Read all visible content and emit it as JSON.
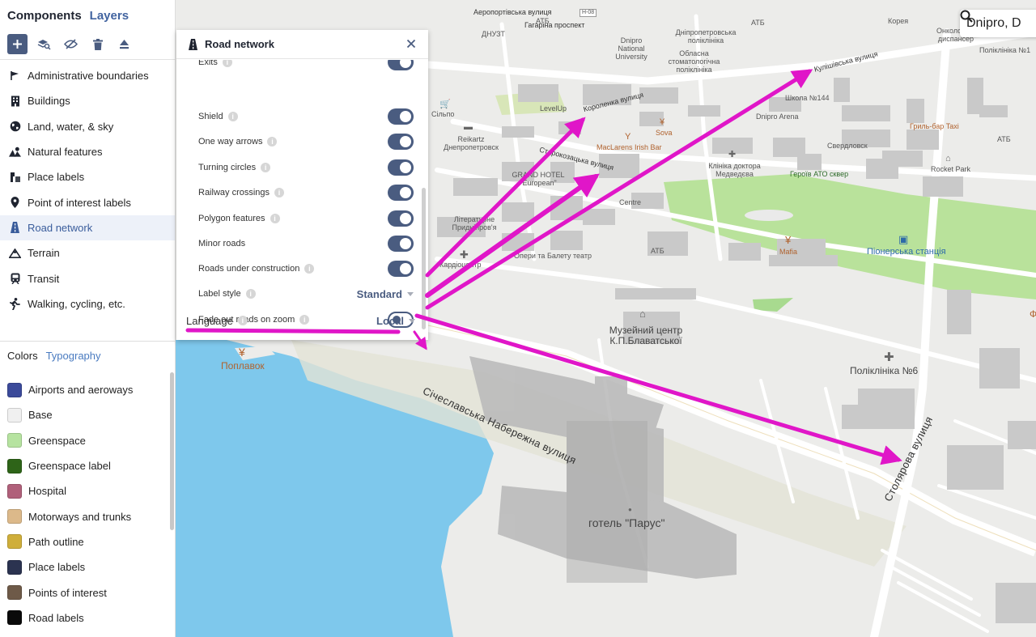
{
  "sidebar": {
    "tabs": {
      "components": "Components",
      "layers": "Layers"
    },
    "components": [
      {
        "label": "Administrative boundaries",
        "icon": "flag-icon"
      },
      {
        "label": "Buildings",
        "icon": "building-icon"
      },
      {
        "label": "Land, water, & sky",
        "icon": "globe-icon"
      },
      {
        "label": "Natural features",
        "icon": "mountain-trees-icon"
      },
      {
        "label": "Place labels",
        "icon": "place-labels-icon"
      },
      {
        "label": "Point of interest labels",
        "icon": "pin-icon"
      },
      {
        "label": "Road network",
        "icon": "road-icon",
        "active": true
      },
      {
        "label": "Terrain",
        "icon": "terrain-icon"
      },
      {
        "label": "Transit",
        "icon": "train-icon"
      },
      {
        "label": "Walking, cycling, etc.",
        "icon": "walking-icon"
      }
    ],
    "subtabs": {
      "colors": "Colors",
      "typography": "Typography"
    },
    "colors": [
      {
        "label": "Airports and aeroways",
        "color": "#3b4a9a"
      },
      {
        "label": "Base",
        "color": "#f0f0f0"
      },
      {
        "label": "Greenspace",
        "color": "#b6e3a0"
      },
      {
        "label": "Greenspace label",
        "color": "#2e6418"
      },
      {
        "label": "Hospital",
        "color": "#b0607a"
      },
      {
        "label": "Motorways and trunks",
        "color": "#dcb98a"
      },
      {
        "label": "Path outline",
        "color": "#cfae3a"
      },
      {
        "label": "Place labels",
        "color": "#2b3350"
      },
      {
        "label": "Points of interest",
        "color": "#6e5a48"
      },
      {
        "label": "Road labels",
        "color": "#0a0a0a"
      }
    ]
  },
  "panel": {
    "title": "Road network",
    "rows": [
      {
        "label": "Exits",
        "type": "toggle",
        "on": true
      },
      {
        "label": "Shield",
        "type": "toggle",
        "on": true
      },
      {
        "label": "One way arrows",
        "type": "toggle",
        "on": true
      },
      {
        "label": "Turning circles",
        "type": "toggle",
        "on": true
      },
      {
        "label": "Railway crossings",
        "type": "toggle",
        "on": true
      },
      {
        "label": "Polygon features",
        "type": "toggle",
        "on": true
      },
      {
        "label": "Minor roads",
        "type": "toggle",
        "on": true
      },
      {
        "label": "Roads under construction",
        "type": "toggle",
        "on": true
      },
      {
        "label": "Label style",
        "type": "select",
        "value": "Standard"
      },
      {
        "label": "Fade out roads on zoom",
        "type": "toggle",
        "on": false
      }
    ],
    "language": {
      "label": "Language",
      "value": "Local"
    }
  },
  "map": {
    "search_text": "Dnipro, D",
    "labels": {
      "street_kulishivska": "Кулішівська вулиця",
      "street_korolenka": "Короленка вулиця",
      "street_starokozatska": "Старокозацька вулиця",
      "street_sicheslavska": "Січеславська Набережна вулиця",
      "street_stoliarova": "Столярова вулиця",
      "street_aeroportivska": "Аеропортівська вулиця",
      "street_haharina": "Гагаріна проспект",
      "road_shield": "H-08",
      "poi_dnuzt": "ДНУЗТ",
      "poi_atb1": "АТБ",
      "poi_atb2": "АТБ",
      "poi_atb3": "АТБ",
      "poi_atb4": "АТБ",
      "poi_dnipro_univ": "Dnipro National University",
      "poi_dental": "Обласна стоматологічна поліклініка",
      "poi_dnipro_polyclinic": "Дніпропетровська поліклініка",
      "poi_korea": "Корея",
      "poi_oncology": "Онкологічний диспансер",
      "poi_polyclinic1": "Поліклініка №1",
      "poi_silpo": "Сільпо",
      "poi_levelup": "LevelUp",
      "poi_sova": "Sova",
      "poi_school144": "Школа №144",
      "poi_dnipro_arena": "Dnipro Arena",
      "poi_grill_bar": "Гриль-бар Taxi",
      "poi_reikartz": "Reikartz Днепропетровск",
      "poi_maclarens": "MacLarens Irish Bar",
      "poi_sverdlovsk": "Свердловск",
      "poi_rocket_park": "Rocket Park",
      "poi_grand_hotel": "GRAND HOTEL \"European\"",
      "poi_medvedeva": "Клініка доктора Медведєва",
      "poi_heroes_square": "Героїв АТО сквер",
      "poi_centre": "Centre",
      "poi_literaturne": "Літературне Придніпров'я",
      "poi_pionerska": "Піонерська станція",
      "poi_kardiocentr": "Кардіоцентр",
      "poi_opera": "Опери та Балету театр",
      "poi_mafia": "Mafia",
      "poi_museum": "Музейний центр К.П.Блаватської",
      "poi_poplavok": "Поплавок",
      "poi_polyclinic6": "Поліклініка №6",
      "poi_hotel_parus": "готель \"Парус\"",
      "poi_edge": "Ф"
    }
  },
  "colors": {
    "accent": "#4a5c80",
    "active_blue": "#3a5d9c",
    "annotation_magenta": "#e016c8",
    "water": "#7ec8ec",
    "park": "#b9e29b"
  }
}
